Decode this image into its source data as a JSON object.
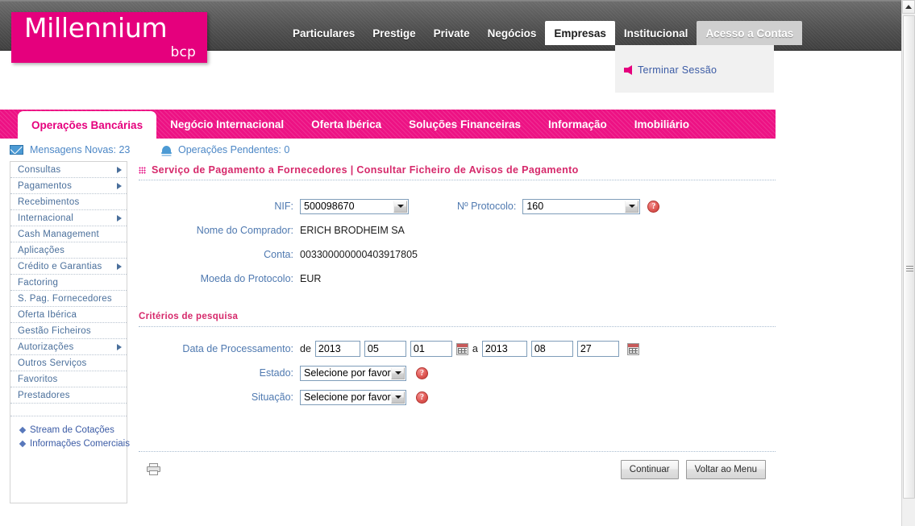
{
  "brand": {
    "logo_main": "Millennium",
    "logo_sub": "bcp",
    "pink": "#e5007d",
    "tab_pink": "#ed1284",
    "title_pink": "#d6296b",
    "link_blue": "#3b5ba5",
    "label_blue": "#4f79b0"
  },
  "topnav": {
    "items": [
      {
        "label": "Particulares",
        "state": "normal"
      },
      {
        "label": "Prestige",
        "state": "normal"
      },
      {
        "label": "Private",
        "state": "normal"
      },
      {
        "label": "Negócios",
        "state": "normal"
      },
      {
        "label": "Empresas",
        "state": "selected"
      },
      {
        "label": "Institucional",
        "state": "normal"
      },
      {
        "label": "Acesso a Contas",
        "state": "light"
      }
    ]
  },
  "session": {
    "logout_label": "Terminar Sessão"
  },
  "pinktabs": {
    "items": [
      {
        "label": "Operações Bancárias",
        "state": "selected"
      },
      {
        "label": "Negócio Internacional",
        "state": "normal"
      },
      {
        "label": "Oferta Ibérica",
        "state": "normal"
      },
      {
        "label": "Soluções Financeiras",
        "state": "normal"
      },
      {
        "label": "Informação",
        "state": "normal"
      },
      {
        "label": "Imobiliário",
        "state": "normal"
      }
    ]
  },
  "statusbar": {
    "messages_label": "Mensagens Novas: 23",
    "pending_label": "Operações Pendentes: 0"
  },
  "sidebar": {
    "items": [
      {
        "label": "Consultas",
        "has_arrow": true
      },
      {
        "label": "Pagamentos",
        "has_arrow": true
      },
      {
        "label": "Recebimentos",
        "has_arrow": false
      },
      {
        "label": "Internacional",
        "has_arrow": true
      },
      {
        "label": "Cash Management",
        "has_arrow": false
      },
      {
        "label": "Aplicações",
        "has_arrow": false
      },
      {
        "label": "Crédito e Garantias",
        "has_arrow": true
      },
      {
        "label": "Factoring",
        "has_arrow": false
      },
      {
        "label": "S. Pag. Fornecedores",
        "has_arrow": false
      },
      {
        "label": "Oferta Ibérica",
        "has_arrow": false
      },
      {
        "label": "Gestão Ficheiros",
        "has_arrow": false
      },
      {
        "label": "Autorizações",
        "has_arrow": true
      },
      {
        "label": "Outros Serviços",
        "has_arrow": false
      },
      {
        "label": "Favoritos",
        "has_arrow": false
      },
      {
        "label": "Prestadores",
        "has_arrow": false
      }
    ],
    "links": [
      {
        "label": "Stream de Cotações"
      },
      {
        "label": "Informações Comerciais"
      }
    ]
  },
  "page": {
    "title": "Serviço de Pagamento a Fornecedores | Consultar Ficheiro de Avisos de Pagamento"
  },
  "form": {
    "nif_label": "NIF:",
    "nif_value": "500098670",
    "protocolo_label": "Nº Protocolo:",
    "protocolo_value": "160",
    "comprador_label": "Nome do Comprador:",
    "comprador_value": "ERICH BRODHEIM SA",
    "conta_label": "Conta:",
    "conta_value": "003300000000403917805",
    "moeda_label": "Moeda do Protocolo:",
    "moeda_value": "EUR",
    "help_glyph": "?"
  },
  "criteria": {
    "section_title": "Critérios de pesquisa",
    "date_label": "Data de Processamento:",
    "from_word": "de",
    "to_word": "a",
    "from_year": "2013",
    "from_month": "05",
    "from_day": "01",
    "to_year": "2013",
    "to_month": "08",
    "to_day": "27",
    "estado_label": "Estado:",
    "estado_value": "Selecione por favor",
    "situacao_label": "Situação:",
    "situacao_value": "Selecione por favor"
  },
  "actions": {
    "continue_label": "Continuar",
    "back_label": "Voltar ao Menu"
  }
}
